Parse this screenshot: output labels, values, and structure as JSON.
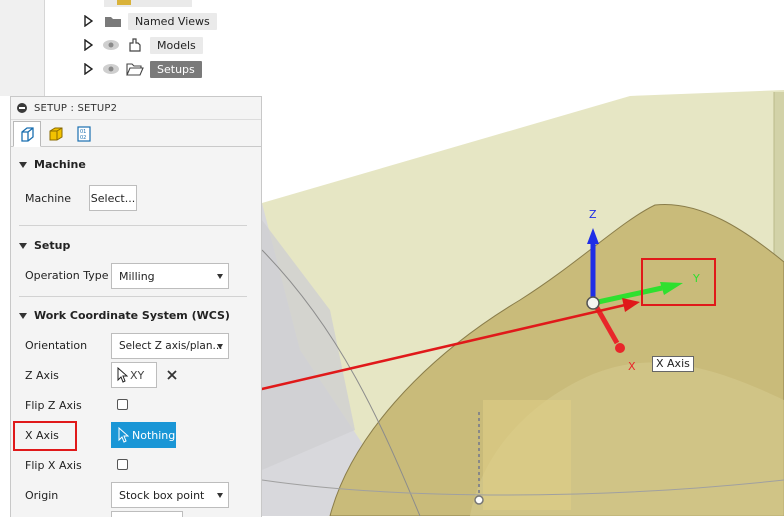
{
  "tree": {
    "items": [
      {
        "label": "Named Views",
        "has_eye": false,
        "selected": false
      },
      {
        "label": "Models",
        "has_eye": true,
        "selected": false
      },
      {
        "label": "Setups",
        "has_eye": true,
        "selected": true
      }
    ]
  },
  "panel": {
    "title": "SETUP : SETUP2",
    "tabs": [
      "setup-tab",
      "stock-tab",
      "post-process-tab"
    ],
    "sections": {
      "machine": {
        "title": "Machine",
        "machine_label": "Machine",
        "machine_button": "Select..."
      },
      "setup": {
        "title": "Setup",
        "operation_type_label": "Operation Type",
        "operation_type_value": "Milling"
      },
      "wcs": {
        "title": "Work Coordinate System (WCS)",
        "orientation_label": "Orientation",
        "orientation_value": "Select Z axis/plan...",
        "z_axis_label": "Z Axis",
        "z_axis_value": "XY",
        "flip_z_label": "Flip Z Axis",
        "x_axis_label": "X Axis",
        "x_axis_value": "Nothing",
        "flip_x_label": "Flip X Axis",
        "origin_label": "Origin",
        "origin_value": "Stock box point"
      }
    }
  },
  "viewport": {
    "axes": {
      "z": "Z",
      "y": "Y",
      "x": "X"
    },
    "tooltip": "X Axis"
  },
  "colors": {
    "model_fill": "#c8bb7c",
    "stock_fill": "#dcdcb0",
    "z_axis": "#1f2ee6",
    "y_axis": "#2fe02f",
    "x_axis": "#e8262a",
    "annotation": "#e0191a",
    "selection_blue": "#1a96d6"
  }
}
